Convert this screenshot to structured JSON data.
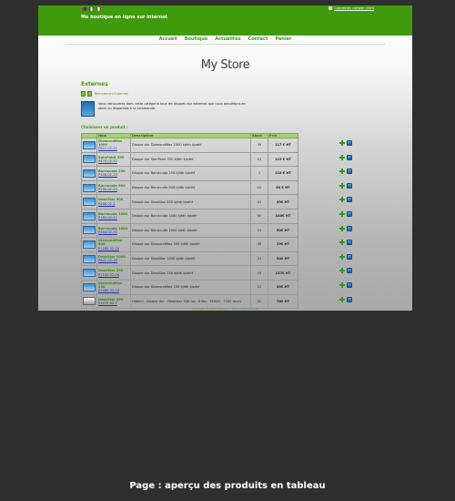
{
  "header": {
    "tagline": "Ma boutique en ligne sur internet",
    "login_link": "Connexion compte client"
  },
  "nav": [
    "Accueil",
    "Boutique",
    "Actualités",
    "Contact",
    "Panier"
  ],
  "brand": "My Store",
  "category": {
    "title": "Externes",
    "breadcrumb": "Bienvenue>Externes",
    "description": "Vous retrouverez dans cette catégorie tous les disques dur externes que nous possédons en stock ou disponible à la commande."
  },
  "products_label": "Choisissez un produit :",
  "table": {
    "headers": [
      "Nom",
      "Description",
      "Stock",
      "Prix"
    ],
    "rows": [
      {
        "name": "DiamondMax 1000",
        "ref": "P007-02-21",
        "desc": "Disque dur DiamondMax 1000 kjfdh kjsdhf",
        "stock": "39",
        "price": "117 €  HT"
      },
      {
        "name": "SpinPoint 250",
        "ref": "P470-02-22",
        "desc": "Disque dur SpinPoint 250 kjfdh kjsdhf",
        "stock": "41",
        "price": "115 € HT"
      },
      {
        "name": "Barracuda 250",
        "ref": "P348-02-23",
        "desc": "Disque dur Barracuda 250 kjfdh kjsdhf",
        "stock": "1",
        "price": "118 € HT"
      },
      {
        "name": "Barracuda 500",
        "ref": "P230-02-24",
        "desc": "Disque dur Barracuda 500 kjfdh kjsdhf",
        "stock": "10",
        "price": "64 € HT"
      },
      {
        "name": "DeskStar 500",
        "ref": "P466-02-2",
        "desc": "Disque dur DeskStar 500 kjfdh kjsdhf",
        "stock": "41",
        "price": "49€ HT"
      },
      {
        "name": "Barracuda 1000",
        "ref": "P182-02-12",
        "desc": "Disque dur Barracuda 1000 kjfdh kjsdhf",
        "stock": "50",
        "price": "140€ HT"
      },
      {
        "name": "Barracuda 1000",
        "ref": "P364-02-25",
        "desc": "Disque dur Barracuda 1000 kjfdh kjsdhf",
        "stock": "15",
        "price": "50€ HT"
      },
      {
        "name": "DiamondMax 500",
        "ref": "P1185-02-20",
        "desc": "Disque dur DiamondMax 500 kjfdh kjsdhf",
        "stock": "39",
        "price": "29€ HT"
      },
      {
        "name": "DeskStar 1000",
        "ref": "P801-02-18",
        "desc": "Disque dur DeskStar 1000 kjfdh kjsdhf",
        "stock": "21",
        "price": "54€ HT"
      },
      {
        "name": "DeskStar 250",
        "ref": "P1140-02-16",
        "desc": "Disque dur DeskStar 250 kjfdh kjsdhf",
        "stock": "19",
        "price": "137€ HT"
      },
      {
        "name": "DiamondMax 250",
        "ref": "P1480-02-19",
        "desc": "Disque dur DiamondMax 250 kjfdh kjsdhf",
        "stock": "12",
        "price": "49€ HT"
      },
      {
        "name": "DeskStar 500",
        "ref": "P1470-02-7",
        "desc": "Hitachi - Disque dur - Deskstar 500 Go - 8 Mo - 7K500 - 7200 tours",
        "stock": "32",
        "price": "78€ HT"
      }
    ]
  },
  "footer": "Copyright © 2008 MyStore - Tous droits réservés",
  "caption": "Page : aperçu des produits en tableau"
}
